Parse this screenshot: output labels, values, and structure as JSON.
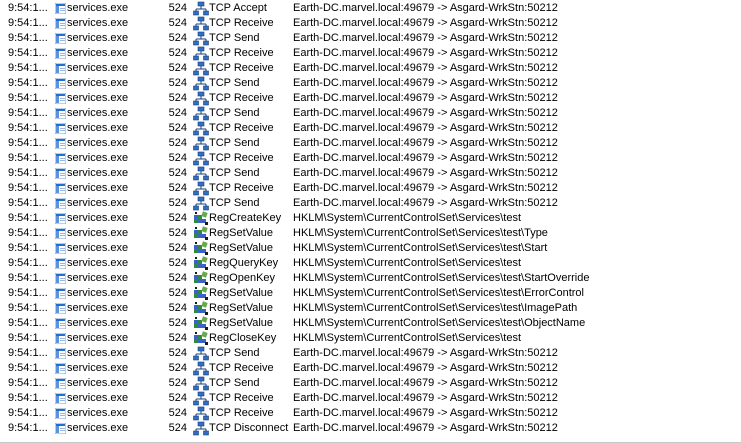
{
  "events": [
    {
      "time": "9:54:1...",
      "process": "services.exe",
      "pid": "524",
      "op_icon": "network-icon",
      "operation": "TCP Accept",
      "path": "Earth-DC.marvel.local:49679 -> Asgard-WrkStn:50212"
    },
    {
      "time": "9:54:1...",
      "process": "services.exe",
      "pid": "524",
      "op_icon": "network-icon",
      "operation": "TCP Receive",
      "path": "Earth-DC.marvel.local:49679 -> Asgard-WrkStn:50212"
    },
    {
      "time": "9:54:1...",
      "process": "services.exe",
      "pid": "524",
      "op_icon": "network-icon",
      "operation": "TCP Send",
      "path": "Earth-DC.marvel.local:49679 -> Asgard-WrkStn:50212"
    },
    {
      "time": "9:54:1...",
      "process": "services.exe",
      "pid": "524",
      "op_icon": "network-icon",
      "operation": "TCP Receive",
      "path": "Earth-DC.marvel.local:49679 -> Asgard-WrkStn:50212"
    },
    {
      "time": "9:54:1...",
      "process": "services.exe",
      "pid": "524",
      "op_icon": "network-icon",
      "operation": "TCP Receive",
      "path": "Earth-DC.marvel.local:49679 -> Asgard-WrkStn:50212"
    },
    {
      "time": "9:54:1...",
      "process": "services.exe",
      "pid": "524",
      "op_icon": "network-icon",
      "operation": "TCP Send",
      "path": "Earth-DC.marvel.local:49679 -> Asgard-WrkStn:50212"
    },
    {
      "time": "9:54:1...",
      "process": "services.exe",
      "pid": "524",
      "op_icon": "network-icon",
      "operation": "TCP Receive",
      "path": "Earth-DC.marvel.local:49679 -> Asgard-WrkStn:50212"
    },
    {
      "time": "9:54:1...",
      "process": "services.exe",
      "pid": "524",
      "op_icon": "network-icon",
      "operation": "TCP Send",
      "path": "Earth-DC.marvel.local:49679 -> Asgard-WrkStn:50212"
    },
    {
      "time": "9:54:1...",
      "process": "services.exe",
      "pid": "524",
      "op_icon": "network-icon",
      "operation": "TCP Receive",
      "path": "Earth-DC.marvel.local:49679 -> Asgard-WrkStn:50212"
    },
    {
      "time": "9:54:1...",
      "process": "services.exe",
      "pid": "524",
      "op_icon": "network-icon",
      "operation": "TCP Send",
      "path": "Earth-DC.marvel.local:49679 -> Asgard-WrkStn:50212"
    },
    {
      "time": "9:54:1...",
      "process": "services.exe",
      "pid": "524",
      "op_icon": "network-icon",
      "operation": "TCP Receive",
      "path": "Earth-DC.marvel.local:49679 -> Asgard-WrkStn:50212"
    },
    {
      "time": "9:54:1...",
      "process": "services.exe",
      "pid": "524",
      "op_icon": "network-icon",
      "operation": "TCP Send",
      "path": "Earth-DC.marvel.local:49679 -> Asgard-WrkStn:50212"
    },
    {
      "time": "9:54:1...",
      "process": "services.exe",
      "pid": "524",
      "op_icon": "network-icon",
      "operation": "TCP Receive",
      "path": "Earth-DC.marvel.local:49679 -> Asgard-WrkStn:50212"
    },
    {
      "time": "9:54:1...",
      "process": "services.exe",
      "pid": "524",
      "op_icon": "network-icon",
      "operation": "TCP Send",
      "path": "Earth-DC.marvel.local:49679 -> Asgard-WrkStn:50212"
    },
    {
      "time": "9:54:1...",
      "process": "services.exe",
      "pid": "524",
      "op_icon": "registry-icon",
      "operation": "RegCreateKey",
      "path": "HKLM\\System\\CurrentControlSet\\Services\\test"
    },
    {
      "time": "9:54:1...",
      "process": "services.exe",
      "pid": "524",
      "op_icon": "registry-icon",
      "operation": "RegSetValue",
      "path": "HKLM\\System\\CurrentControlSet\\Services\\test\\Type"
    },
    {
      "time": "9:54:1...",
      "process": "services.exe",
      "pid": "524",
      "op_icon": "registry-icon",
      "operation": "RegSetValue",
      "path": "HKLM\\System\\CurrentControlSet\\Services\\test\\Start"
    },
    {
      "time": "9:54:1...",
      "process": "services.exe",
      "pid": "524",
      "op_icon": "registry-icon",
      "operation": "RegQueryKey",
      "path": "HKLM\\System\\CurrentControlSet\\Services\\test"
    },
    {
      "time": "9:54:1...",
      "process": "services.exe",
      "pid": "524",
      "op_icon": "registry-icon",
      "operation": "RegOpenKey",
      "path": "HKLM\\System\\CurrentControlSet\\Services\\test\\StartOverride"
    },
    {
      "time": "9:54:1...",
      "process": "services.exe",
      "pid": "524",
      "op_icon": "registry-icon",
      "operation": "RegSetValue",
      "path": "HKLM\\System\\CurrentControlSet\\Services\\test\\ErrorControl"
    },
    {
      "time": "9:54:1...",
      "process": "services.exe",
      "pid": "524",
      "op_icon": "registry-icon",
      "operation": "RegSetValue",
      "path": "HKLM\\System\\CurrentControlSet\\Services\\test\\ImagePath"
    },
    {
      "time": "9:54:1...",
      "process": "services.exe",
      "pid": "524",
      "op_icon": "registry-icon",
      "operation": "RegSetValue",
      "path": "HKLM\\System\\CurrentControlSet\\Services\\test\\ObjectName"
    },
    {
      "time": "9:54:1...",
      "process": "services.exe",
      "pid": "524",
      "op_icon": "registry-icon",
      "operation": "RegCloseKey",
      "path": "HKLM\\System\\CurrentControlSet\\Services\\test"
    },
    {
      "time": "9:54:1...",
      "process": "services.exe",
      "pid": "524",
      "op_icon": "network-icon",
      "operation": "TCP Send",
      "path": "Earth-DC.marvel.local:49679 -> Asgard-WrkStn:50212"
    },
    {
      "time": "9:54:1...",
      "process": "services.exe",
      "pid": "524",
      "op_icon": "network-icon",
      "operation": "TCP Receive",
      "path": "Earth-DC.marvel.local:49679 -> Asgard-WrkStn:50212"
    },
    {
      "time": "9:54:1...",
      "process": "services.exe",
      "pid": "524",
      "op_icon": "network-icon",
      "operation": "TCP Send",
      "path": "Earth-DC.marvel.local:49679 -> Asgard-WrkStn:50212"
    },
    {
      "time": "9:54:1...",
      "process": "services.exe",
      "pid": "524",
      "op_icon": "network-icon",
      "operation": "TCP Receive",
      "path": "Earth-DC.marvel.local:49679 -> Asgard-WrkStn:50212"
    },
    {
      "time": "9:54:1...",
      "process": "services.exe",
      "pid": "524",
      "op_icon": "network-icon",
      "operation": "TCP Receive",
      "path": "Earth-DC.marvel.local:49679 -> Asgard-WrkStn:50212"
    },
    {
      "time": "9:54:1...",
      "process": "services.exe",
      "pid": "524",
      "op_icon": "network-icon",
      "operation": "TCP Disconnect",
      "path": "Earth-DC.marvel.local:49679 -> Asgard-WrkStn:50212"
    }
  ],
  "colors": {
    "background": "#ffffff",
    "text": "#000000",
    "process_icon": "#1f6fd1",
    "network_icon_blue": "#2f6fc4",
    "network_icon_dark": "#1a3f7a",
    "registry_icon_green": "#2e8b3e",
    "registry_icon_blue": "#3a62c8",
    "gridline": "#c8c8c8"
  }
}
